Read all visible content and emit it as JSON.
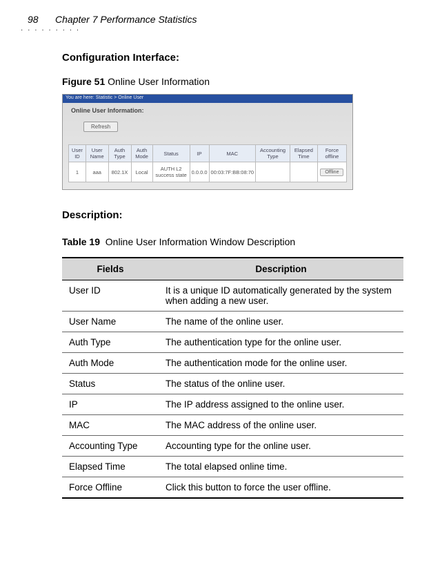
{
  "header": {
    "page_number": "98",
    "chapter": "Chapter 7 Performance Statistics"
  },
  "section_heading": "Configuration Interface:",
  "figure": {
    "label": "Figure 51",
    "caption": "Online User Information"
  },
  "screenshot": {
    "breadcrumb": "You are here: Statistic > Online User",
    "panel_title": "Online User Information:",
    "refresh": "Refresh",
    "headers": {
      "user_id": "User ID",
      "user_name": "User Name",
      "auth_type": "Auth Type",
      "auth_mode": "Auth Mode",
      "status": "Status",
      "ip": "IP",
      "mac": "MAC",
      "acct_type": "Accounting Type",
      "elapsed": "Elapsed Time",
      "force": "Force offline"
    },
    "row": {
      "user_id": "1",
      "user_name": "aaa",
      "auth_type": "802.1X",
      "auth_mode": "Local",
      "status": "AUTH L2 success state",
      "ip": "0.0.0.0",
      "mac": "00:03:7F:BB:08:70",
      "acct_type": "",
      "elapsed": "",
      "force": "Offline"
    }
  },
  "description_heading": "Description:",
  "table": {
    "label": "Table 19",
    "caption": "Online User Information Window Description",
    "head_fields": "Fields",
    "head_desc": "Description",
    "rows": [
      {
        "field": "User ID",
        "desc": "It is a unique ID automatically generated by the system when adding a new user."
      },
      {
        "field": "User Name",
        "desc": "The name of the online user."
      },
      {
        "field": "Auth Type",
        "desc": "The authentication type for the online user."
      },
      {
        "field": "Auth Mode",
        "desc": "The authentication mode for the online user."
      },
      {
        "field": "Status",
        "desc": "The status of the online user."
      },
      {
        "field": "IP",
        "desc": "The IP address assigned to the online user."
      },
      {
        "field": "MAC",
        "desc": "The MAC address of the online user."
      },
      {
        "field": "Accounting Type",
        "desc": "Accounting type for the online user."
      },
      {
        "field": "Elapsed Time",
        "desc": "The total elapsed online time."
      },
      {
        "field": "Force Offline",
        "desc": "Click this button to force the user offline."
      }
    ]
  }
}
